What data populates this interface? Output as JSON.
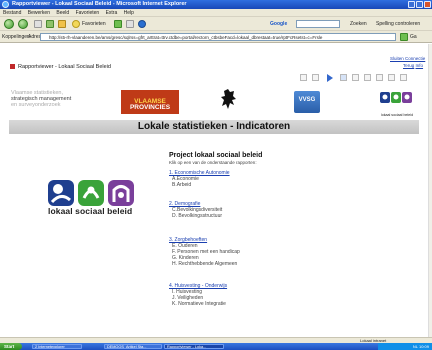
{
  "window": {
    "title": "Rapportviewer - Lokaal Sociaal Beleid - Microsoft Internet Explorer"
  },
  "menu": {
    "items": [
      "Bestand",
      "Bewerken",
      "Beeld",
      "Favorieten",
      "Extra",
      "Help"
    ]
  },
  "toolbar": {
    "favorites_label": "Favorieten",
    "google_label": "Google",
    "search_label": "Zoeken",
    "spelling_label": "Spelling controleren"
  },
  "address": {
    "label": "Koppelingen",
    "adres_label": "Adres",
    "url": "http://s5-rh-vlaanderen.be/ams/gresc/sqlrss=gfrt_arttrat=ttrv.ctdbe=portal/rectorn_ctbsbeFacd=lokaal_dbrestaat=true/rptFcRsetst=c=Frsle"
  },
  "app": {
    "title": "Rapportviewer - Lokaal Sociaal Beleid",
    "top_link_1": "Sluiten Connectie",
    "top_links_2": [
      "Terug",
      "Info"
    ]
  },
  "logos": {
    "strategisch_lines": [
      "Vlaamse statistieken,",
      "strategisch management",
      "en surveyonderzoek"
    ],
    "province_lines": [
      "VLAAMSE",
      "PROVINCIES"
    ],
    "vvsg": "VVSG",
    "small_caption": "lokaal sociaal beleid"
  },
  "header": {
    "title": "Lokale statistieken - Indicatoren"
  },
  "brand": {
    "big_caption": "lokaal sociaal beleid"
  },
  "project": {
    "title": "Project lokaal sociaal beleid",
    "subtitle": "Klik op een van de onderstaande rapporten:",
    "categories": [
      {
        "label": "1. Economische Autonomie",
        "items": [
          "A.Economie",
          "B.Arbeid"
        ]
      },
      {
        "label": "2. Demografie",
        "items": [
          "C.Bevolkingsdiversiteit",
          "D. Bevolkingsstructuur"
        ]
      },
      {
        "label": "3. Zorgbehoeften",
        "items": [
          "E. Ouderen",
          "F. Personen met een handicap",
          "G. Kinderen",
          "H. Rechthebbende Algemeen"
        ]
      },
      {
        "label": "4. Huisvesting - Onderwijs",
        "items": [
          "I. Huisvesting",
          "J. Veiligheden",
          "K. Normatieve Integratie"
        ]
      }
    ]
  },
  "status": {
    "zone": "Lokaal intranet"
  },
  "taskbar": {
    "start": "Start",
    "buttons": [
      "2 Internetexplorer",
      "DEMOOS_Artikel Sta...",
      "Rapportviewer - Loka..."
    ],
    "tray": "NL  10:09"
  },
  "colors": {
    "titlebar": "#1848b8",
    "province_red": "#bf3a17",
    "link_blue": "#1a3fb0",
    "header_grey": "#c8c8c8",
    "brand_blue": "#1f3f8f",
    "brand_green": "#3aa33a",
    "brand_purple": "#7a3f9b"
  }
}
